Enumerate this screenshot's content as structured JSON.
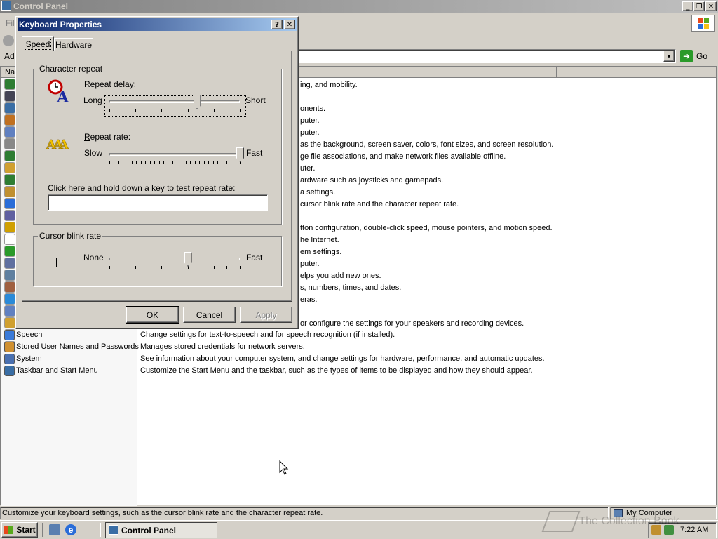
{
  "window": {
    "title": "Control Panel"
  },
  "menu": {
    "file_label": "File"
  },
  "address": {
    "label_abbr": "Add",
    "go_label": "Go"
  },
  "columns": {
    "name_abbr": "Na"
  },
  "partial_comments": [
    "ing, and mobility.",
    "",
    "onents.",
    "puter.",
    "puter.",
    "as the background, screen saver, colors, font sizes, and screen resolution.",
    "ge file associations, and make network files available offline.",
    "uter.",
    "ardware such as joysticks and gamepads.",
    "a settings.",
    "cursor blink rate and the character repeat rate.",
    "",
    "tton configuration, double-click speed, mouse pointers, and motion speed.",
    "he Internet.",
    "em settings.",
    "puter.",
    "elps you add new ones.",
    "s, numbers, times, and dates.",
    "eras.",
    "",
    "or configure the settings for your speakers and recording devices."
  ],
  "items": [
    {
      "name": "Speech",
      "comment": "Change settings for text-to-speech and for speech recognition (if installed)."
    },
    {
      "name": "Stored User Names and Passwords",
      "comment": "Manages stored credentials for network servers."
    },
    {
      "name": "System",
      "comment": "See information about your computer system, and change settings for hardware, performance, and automatic updates."
    },
    {
      "name": "Taskbar and Start Menu",
      "comment": "Customize the Start Menu and the taskbar, such as the types of items to be displayed and how they should appear."
    }
  ],
  "dialog": {
    "title": "Keyboard Properties",
    "tabs": [
      "Speed",
      "Hardware"
    ],
    "char_repeat": {
      "legend": "Character repeat",
      "delay_label": "Repeat delay:",
      "delay_min": "Long",
      "delay_max": "Short",
      "delay_value": 0.67,
      "rate_label": "Repeat rate:",
      "rate_min": "Slow",
      "rate_max": "Fast",
      "rate_value": 1.0,
      "test_label": "Click here and hold down a key to test repeat rate:",
      "test_value": ""
    },
    "cursor_blink": {
      "legend": "Cursor blink rate",
      "min": "None",
      "max": "Fast",
      "value": 0.6
    },
    "buttons": {
      "ok": "OK",
      "cancel": "Cancel",
      "apply": "Apply"
    }
  },
  "status": {
    "text": "Customize your keyboard settings, such as the cursor blink rate and the character repeat rate.",
    "zone": "My Computer"
  },
  "taskbar": {
    "start": "Start",
    "task": "Control Panel",
    "time": "7:22 AM"
  },
  "watermark": "The Collection Book",
  "colors": {
    "title_active": "#0a246a",
    "title_inactive": "#808080",
    "desktop": "#d4d0c8"
  }
}
